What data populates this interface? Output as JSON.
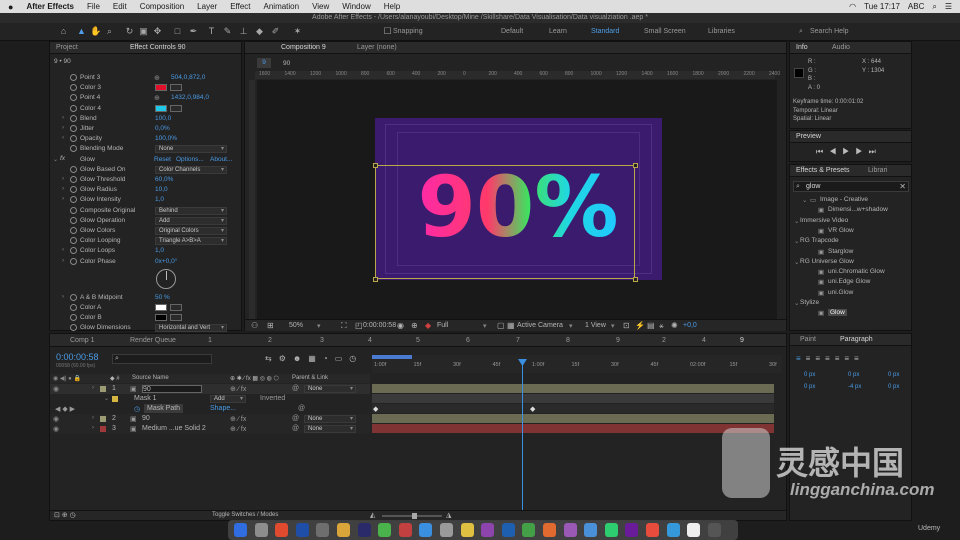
{
  "menubar": {
    "app": "After Effects",
    "items": [
      "File",
      "Edit",
      "Composition",
      "Layer",
      "Effect",
      "Animation",
      "View",
      "Window",
      "Help"
    ],
    "time": "Tue 17:17",
    "input": "ABC"
  },
  "titlebar": "Adobe After Effects - /Users/alanayoubi/Desktop/Mine /Skillshare/Data Visualisation/Data visualziation .aep *",
  "workspaces": {
    "default": "Default",
    "learn": "Learn",
    "standard": "Standard",
    "small": "Small Screen",
    "libraries": "Libraries"
  },
  "search_help": "Search Help",
  "left_panel": {
    "tab_project": "Project",
    "tab_effect": "Effect Controls 90",
    "breadcrumb": "9 • 90",
    "rows": [
      {
        "label": "Point 3",
        "value": "504,0,872,0"
      },
      {
        "label": "Color 3",
        "value": ""
      },
      {
        "label": "Point 4",
        "value": "1432,0,984,0"
      },
      {
        "label": "Color 4",
        "value": ""
      },
      {
        "label": "Blend",
        "value": "100,0"
      },
      {
        "label": "Jitter",
        "value": "0,0%"
      },
      {
        "label": "Opacity",
        "value": "100,0%"
      },
      {
        "label": "Blending Mode",
        "value": "None"
      }
    ],
    "glow_label": "Glow",
    "reset": "Reset",
    "options": "Options...",
    "about": "About...",
    "glow_rows": [
      {
        "label": "Glow Based On",
        "value": "Color Channels",
        "type": "dd"
      },
      {
        "label": "Glow Threshold",
        "value": "60,0%",
        "type": "num"
      },
      {
        "label": "Glow Radius",
        "value": "10,0",
        "type": "num"
      },
      {
        "label": "Glow Intensity",
        "value": "1,0",
        "type": "num"
      },
      {
        "label": "Composite Original",
        "value": "Behind",
        "type": "dd"
      },
      {
        "label": "Glow Operation",
        "value": "Add",
        "type": "dd"
      },
      {
        "label": "Glow Colors",
        "value": "Original Colors",
        "type": "dd"
      },
      {
        "label": "Color Looping",
        "value": "Triangle A>B>A",
        "type": "dd"
      },
      {
        "label": "Color Loops",
        "value": "1,0",
        "type": "num"
      },
      {
        "label": "Color Phase",
        "value": "0x+0,0°",
        "type": "num"
      }
    ],
    "ab_midpoint": {
      "label": "A & B Midpoint",
      "value": "50 %"
    },
    "color_a": "Color A",
    "color_b": "Color B",
    "glow_dimensions": {
      "label": "Glow Dimensions",
      "value": "Horizontal and Vert"
    }
  },
  "comp_panel": {
    "tab": "Composition 9",
    "layer_tab": "Layer (none)",
    "crumb1": "9",
    "crumb2": "90",
    "ruler_ticks": [
      "1600",
      "1400",
      "1200",
      "1000",
      "800",
      "600",
      "400",
      "200",
      "0",
      "200",
      "400",
      "600",
      "800",
      "1000",
      "1200",
      "1400",
      "1600",
      "1800",
      "2000",
      "2200",
      "2400"
    ],
    "display_text": "90%",
    "zoom": "50%",
    "timecode": "0:00:00:58",
    "resolution": "Full",
    "camera": "Active Camera",
    "view": "1 View",
    "exposure": "+0,0"
  },
  "info_panel": {
    "tab": "Info",
    "tab2": "Audio",
    "r": "R :",
    "g": "G :",
    "b": "B :",
    "a": "A :  0",
    "x": "X : 644",
    "y": "Y : 1304",
    "keyframe": "Keyframe time: 0:00:01:02",
    "temporal": "Temporal: Linear",
    "spatial": "Spatial: Linear"
  },
  "preview": {
    "tab": "Preview"
  },
  "effects_presets": {
    "tab": "Effects & Presets",
    "tab2": "Librari",
    "search": "glow",
    "items": [
      {
        "label": "Image - Creative",
        "indent": 2
      },
      {
        "label": "Dimensi...w+shadow",
        "indent": 3
      },
      {
        "label": "Immersive Video",
        "indent": 0
      },
      {
        "label": "VR Glow",
        "indent": 3
      },
      {
        "label": "RG Trapcode",
        "indent": 0
      },
      {
        "label": "Starglow",
        "indent": 3
      },
      {
        "label": "RG Universe Glow",
        "indent": 0
      },
      {
        "label": "uni.Chromatic Glow",
        "indent": 3
      },
      {
        "label": "uni.Edge Glow",
        "indent": 3
      },
      {
        "label": "uni.Glow",
        "indent": 3
      },
      {
        "label": "Stylize",
        "indent": 0
      },
      {
        "label": "Glow",
        "indent": 3
      }
    ]
  },
  "paragraph": {
    "tab1": "Paint",
    "tab2": "Paragraph",
    "v1": "0 px",
    "v2": "0 px",
    "v3": "0 px",
    "v4": "0 px",
    "v5": "-4 px",
    "v6": "0 px"
  },
  "timeline": {
    "tabs": [
      "Comp 1",
      "Render Queue",
      "1",
      "2",
      "3",
      "4",
      "5",
      "6",
      "7",
      "8",
      "9",
      "2",
      "4",
      "9"
    ],
    "timecode": "0:00:00:58",
    "fps": "00058 (60.00 fps)",
    "col_source": "Source Name",
    "col_parent": "Parent & Link",
    "ruler": [
      "1:00f",
      "15f",
      "30f",
      "45f",
      "1:00f",
      "15f",
      "30f",
      "45f",
      "02:00f",
      "15f",
      "30f"
    ],
    "layers": [
      {
        "num": "1",
        "name": "90",
        "parent": "None",
        "color": "#9b9b74"
      },
      {
        "num": "2",
        "name": "90",
        "parent": "None",
        "color": "#9b9b74"
      },
      {
        "num": "3",
        "name": "Medium ...ue Solid 2",
        "parent": "None",
        "color": "#a03a3a"
      }
    ],
    "mask": "Mask 1",
    "mask_mode": "Add",
    "inverted": "Inverted",
    "mask_path": "Mask Path",
    "mask_value": "Shape...",
    "toggle": "Toggle Switches / Modes"
  },
  "watermark": {
    "cn": "灵感中国",
    "url": "lingganchina.com",
    "udemy": "Udemy"
  },
  "colors": {
    "accent": "#4a9be6",
    "color3": "#e0102a",
    "color4": "#1ec8e6",
    "comp_bg": "#3a1b6e",
    "playhead": "#3b8fe0"
  }
}
